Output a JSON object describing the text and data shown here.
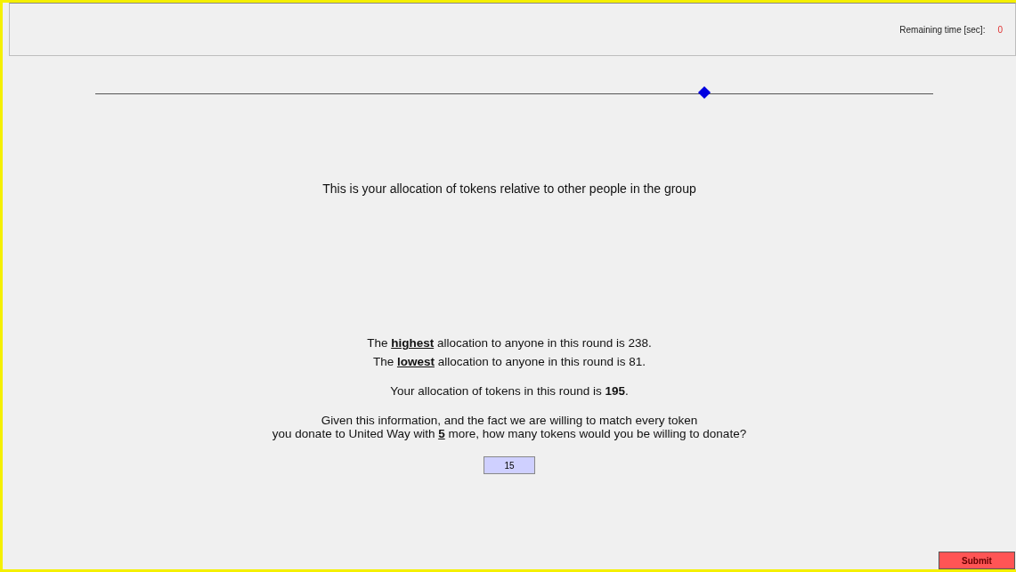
{
  "header": {
    "timer_label": "Remaining time [sec]:",
    "timer_value": "0"
  },
  "slider": {
    "level": 0.727
  },
  "caption": "This is your allocation of tokens relative to other people in the group",
  "lines": [
    {
      "kind": "underlined",
      "text": "The **highest** allocation to anyone in this round is 238."
    },
    {
      "kind": "underlined",
      "text": "The **lowest** allocation to anyone in this round is 81."
    },
    {
      "kind": "bold",
      "text": "Your allocation of tokens in this round is **195**."
    },
    {
      "kind": "underlined",
      "text": "Given this information, and the fact we are willing to match every token\nyou donate to United Way with **5** more, how many tokens would you be willing to donate?"
    }
  ],
  "answer": {
    "value": "15"
  },
  "submit": "Submit"
}
